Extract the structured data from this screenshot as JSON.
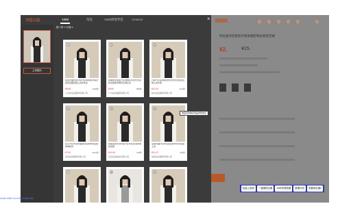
{
  "modal": {
    "brand": "阿里以图",
    "tabs": [
      {
        "label": "1688",
        "active": true
      },
      {
        "label": "淘宝",
        "active": false
      },
      {
        "label": "1688跨境专区",
        "active": false
      },
      {
        "label": "Amazon",
        "active": false
      }
    ],
    "close": "×",
    "upload_label": "上传图片",
    "filters": "图: 8件        ▾ 价格 ▾ ",
    "tooltip": "淘宝同款购买商品详情信息",
    "cards": [
      {
        "num": "1",
        "desc": "女装长袖外套针织开衫春秋新款薄款宽松显瘦百搭上衣外套女",
        "price": "¥8.88",
        "sales": "1299件",
        "shop": "义乌市某某服饰有限公司"
      },
      {
        "num": "2",
        "desc": "夏季新款女装开衫防晒衫外套长款宽松百搭休闲薄款空调衫女",
        "price": "¥9.80",
        "sales": "886件",
        "shop": "广州某某服装有限公司"
      },
      {
        "num": "3",
        "desc": "针织开衫女春秋款外套中长款宽松百搭上衣外搭",
        "price": "¥12.00",
        "sales": "521件",
        "shop": "杭州某某服饰有限公司"
      },
      {
        "num": "4",
        "desc": "女士开衫外套长袖薄款宽松休闲百搭春季新款",
        "price": "¥7.50",
        "sales": "2301件",
        "shop": "深圳某某服饰有限公司"
      },
      {
        "num": "5",
        "desc": "韩版宽松长款针织开衫外套女薄款春秋百搭",
        "price": "¥10.50",
        "sales": "705件",
        "shop": "东莞某某制衣有限公司"
      },
      {
        "num": "6",
        "desc": "显瘦长袖开衫外套女宽松中长款百搭上衣",
        "price": "¥11.20",
        "sales": "433件",
        "shop": "常熟某某服饰有限公司"
      },
      {
        "num": "7",
        "desc": "",
        "price": "",
        "sales": "",
        "shop": ""
      },
      {
        "num": "8",
        "desc": "",
        "price": "",
        "sales": "",
        "shop": ""
      },
      {
        "num": "9",
        "desc": "",
        "price": "",
        "sales": "",
        "shop": ""
      }
    ]
  },
  "background": {
    "title": "阿拉伯风衣套装外贸高端定制长款连衣裙",
    "price": "¥2.",
    "price2": "¥15."
  },
  "footer_link": "detail.1688.com/offer/1688.html",
  "actions": [
    {
      "label": "批量上架到"
    },
    {
      "label": "一键铺货店铺"
    },
    {
      "label": "1688货源查看"
    },
    {
      "label": "数据分析"
    },
    {
      "label": "采集到店铺Z"
    }
  ]
}
